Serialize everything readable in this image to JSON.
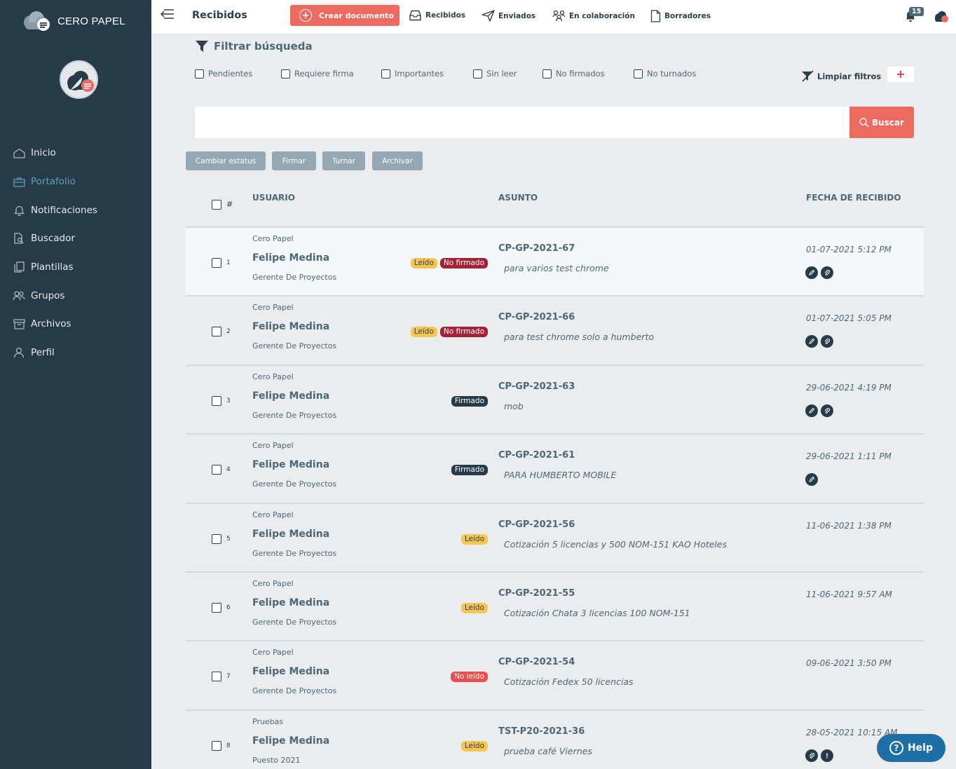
{
  "brand": {
    "name": "CERO PAPEL"
  },
  "sidebar": {
    "items": [
      {
        "label": "Inicio",
        "icon": "home-icon",
        "active": false
      },
      {
        "label": "Portafolio",
        "icon": "briefcase-icon",
        "active": true
      },
      {
        "label": "Notificaciones",
        "icon": "bell-icon",
        "active": false
      },
      {
        "label": "Buscador",
        "icon": "search-document-icon",
        "active": false
      },
      {
        "label": "Plantillas",
        "icon": "templates-icon",
        "active": false
      },
      {
        "label": "Grupos",
        "icon": "group-icon",
        "active": false
      },
      {
        "label": "Archivos",
        "icon": "archive-icon",
        "active": false
      },
      {
        "label": "Perfil",
        "icon": "user-icon",
        "active": false
      }
    ]
  },
  "header": {
    "title": "Recibidos",
    "create_label": "Crear documento",
    "nav": [
      {
        "label": "Recibidos",
        "icon": "inbox-icon"
      },
      {
        "label": "Enviados",
        "icon": "send-icon"
      },
      {
        "label": "En colaboración",
        "icon": "collaboration-icon"
      },
      {
        "label": "Borradores",
        "icon": "draft-icon"
      }
    ],
    "notifications_count": "15"
  },
  "filters": {
    "title": "Filtrar búsqueda",
    "options": [
      "Pendientes",
      "Requiere firma",
      "Importantes",
      "Sin leer",
      "No firmados",
      "No turnados"
    ],
    "clear_label": "Limpiar filtros",
    "add_label": "+"
  },
  "search": {
    "value": "",
    "placeholder": "",
    "button_label": "Buscar"
  },
  "actions": [
    "Cambiar estatus",
    "Firmar",
    "Turnar",
    "Archivar"
  ],
  "table": {
    "columns": {
      "number": "#",
      "user": "USUARIO",
      "subject": "ASUNTO",
      "date": "FECHA DE RECIBIDO"
    },
    "rows": [
      {
        "num": "1",
        "org": "Cero Papel",
        "name": "Felipe Medina",
        "role": "Gerente De Proyectos",
        "badges": [
          {
            "label": "Leído",
            "type": "leido"
          },
          {
            "label": "No firmado",
            "type": "nofirmado"
          }
        ],
        "folio": "CP-GP-2021-67",
        "subject": "para varios test chrome",
        "date": "01-07-2021 5:12 PM",
        "icons": [
          "pen-icon",
          "attachment-icon"
        ]
      },
      {
        "num": "2",
        "org": "Cero Papel",
        "name": "Felipe Medina",
        "role": "Gerente De Proyectos",
        "badges": [
          {
            "label": "Leído",
            "type": "leido"
          },
          {
            "label": "No firmado",
            "type": "nofirmado"
          }
        ],
        "folio": "CP-GP-2021-66",
        "subject": "para test chrome solo a humberto",
        "date": "01-07-2021 5:05 PM",
        "icons": [
          "pen-icon",
          "attachment-icon"
        ]
      },
      {
        "num": "3",
        "org": "Cero Papel",
        "name": "Felipe Medina",
        "role": "Gerente De Proyectos",
        "badges": [
          {
            "label": "Firmado",
            "type": "firmado"
          }
        ],
        "folio": "CP-GP-2021-63",
        "subject": "mob",
        "date": "29-06-2021 4:19 PM",
        "icons": [
          "pen-icon",
          "attachment-icon"
        ]
      },
      {
        "num": "4",
        "org": "Cero Papel",
        "name": "Felipe Medina",
        "role": "Gerente De Proyectos",
        "badges": [
          {
            "label": "Firmado",
            "type": "firmado"
          }
        ],
        "folio": "CP-GP-2021-61",
        "subject": "PARA HUMBERTO MOBILE",
        "date": "29-06-2021 1:11 PM",
        "icons": [
          "pen-icon"
        ]
      },
      {
        "num": "5",
        "org": "Cero Papel",
        "name": "Felipe Medina",
        "role": "Gerente De Proyectos",
        "badges": [
          {
            "label": "Leído",
            "type": "leido"
          }
        ],
        "folio": "CP-GP-2021-56",
        "subject": "Cotización 5 licencias y 500 NOM-151 KAO Hoteles",
        "date": "11-06-2021 1:38 PM",
        "icons": []
      },
      {
        "num": "6",
        "org": "Cero Papel",
        "name": "Felipe Medina",
        "role": "Gerente De Proyectos",
        "badges": [
          {
            "label": "Leído",
            "type": "leido"
          }
        ],
        "folio": "CP-GP-2021-55",
        "subject": "Cotización Chata 3 licencias 100 NOM-151",
        "date": "11-06-2021 9:57 AM",
        "icons": []
      },
      {
        "num": "7",
        "org": "Cero Papel",
        "name": "Felipe Medina",
        "role": "Gerente De Proyectos",
        "badges": [
          {
            "label": "No leído",
            "type": "noleido"
          }
        ],
        "folio": "CP-GP-2021-54",
        "subject": "Cotización Fedex 50 licencias",
        "date": "09-06-2021 3:50 PM",
        "icons": []
      },
      {
        "num": "8",
        "org": "Pruebas",
        "name": "Felipe Medina",
        "role": "Puesto 2021",
        "badges": [
          {
            "label": "Leído",
            "type": "leido"
          }
        ],
        "folio": "TST-P20-2021-36",
        "subject": "prueba café Viernes",
        "date": "28-05-2021 10:15 AM",
        "icons": [
          "attachment-icon",
          "alert-icon"
        ]
      }
    ]
  },
  "help": {
    "label": "Help"
  }
}
